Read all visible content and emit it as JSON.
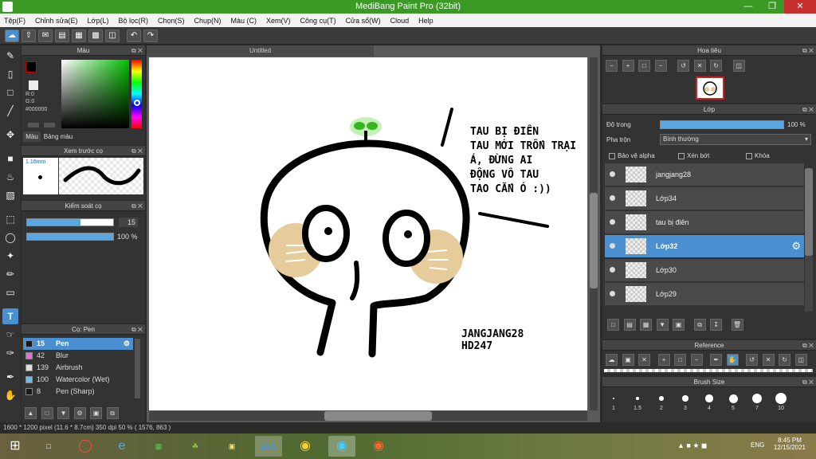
{
  "window": {
    "title": "MediBang Paint Pro (32bit)"
  },
  "menu": [
    "Tệp(F)",
    "Chỉnh sửa(E)",
    "Lớp(L)",
    "Bộ lọc(R)",
    "Chọn(S)",
    "Chụp(N)",
    "Màu (C)",
    "Xem(V)",
    "Công cụ(T)",
    "Cửa sổ(W)",
    "Cloud",
    "Help"
  ],
  "panels": {
    "color": {
      "title": "Màu",
      "r": "R:0",
      "g": "G:0",
      "hex": "#000000",
      "tab1": "Màu",
      "tab2": "Bảng màu"
    },
    "brush_preview": {
      "title": "Xem trước cọ",
      "size": "1.16mm"
    },
    "brush_control": {
      "title": "Kiểm soát cọ",
      "size": "15",
      "opacity": "100 %",
      "opacity_value": 1.0,
      "size_fraction": 0.62
    },
    "brush_list": {
      "title": "Cọ: Pen",
      "items": [
        {
          "num": "15",
          "name": "Pen",
          "color": "#1a1a1a",
          "selected": true
        },
        {
          "num": "42",
          "name": "Blur",
          "color": "#e070e0"
        },
        {
          "num": "139",
          "name": "Airbrush",
          "color": "#dddddd"
        },
        {
          "num": "100",
          "name": "Watercolor (Wet)",
          "color": "#60c0f0"
        },
        {
          "num": "8",
          "name": "Pen (Sharp)",
          "color": "#1a1a1a"
        }
      ]
    },
    "navigator": {
      "title": "Hoa tiêu"
    },
    "layers": {
      "title": "Lớp",
      "opacity_label": "Độ trong",
      "opacity": "100 %",
      "opacity_value": 1.0,
      "blend_label": "Pha trộn",
      "blend": "Bình thường",
      "alpha_protect": "Bảo vệ alpha",
      "clipping": "Xén bớt",
      "lock": "Khóa",
      "items": [
        {
          "name": "jangjang28"
        },
        {
          "name": "Lớp34"
        },
        {
          "name": "tau bị điên"
        },
        {
          "name": "Lớp32",
          "selected": true
        },
        {
          "name": "Lớp30"
        },
        {
          "name": "Lớp29"
        }
      ]
    },
    "reference": {
      "title": "Reference"
    },
    "brush_size": {
      "title": "Brush Size",
      "sizes": [
        "1",
        "1.5",
        "2",
        "3",
        "4",
        "5",
        "7",
        "10"
      ]
    }
  },
  "canvas": {
    "tab": "Untitled",
    "speech": [
      "TAU BỊ ĐIÊN",
      "TAU MỚI TRỐN TRẠI",
      "Á, ĐỪNG AI",
      "ĐỘNG VÔ TAU",
      "TAO CẮN Ó :))"
    ],
    "signature": [
      "JANGJANG28",
      "HD247"
    ]
  },
  "status": {
    "text": "1600 * 1200 pixel   (11.6 * 8.7cm)   350 dpi   50 %   ( 1576, 863 )"
  },
  "taskbar": {
    "time": "8:45 PM",
    "date": "12/15/2021",
    "lang": "ENG"
  }
}
